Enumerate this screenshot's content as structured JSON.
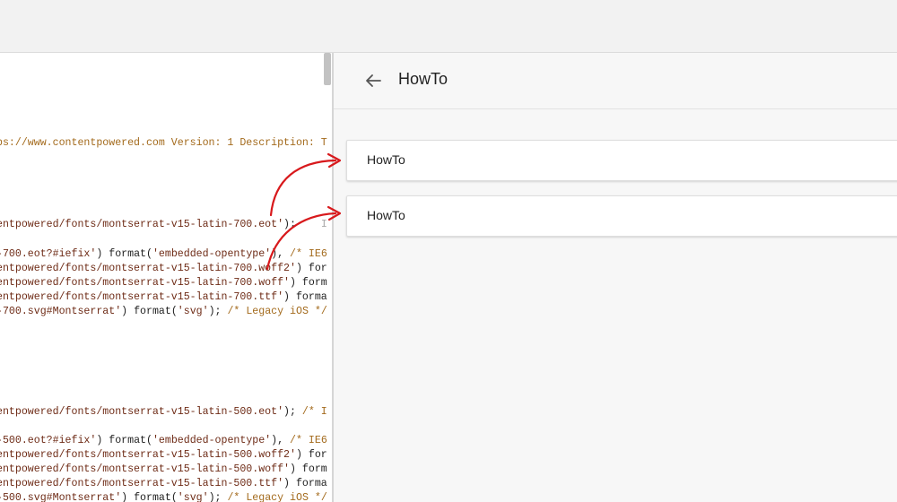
{
  "editor": {
    "lines": [
      {
        "parts": [
          {
            "t": "ps://www.contentpowered.com Version: 1 Description: T",
            "c": "cm"
          }
        ]
      },
      {
        "parts": [
          {
            "t": "entpowered/fonts/montserrat-v15-latin-700.eot'",
            "c": "str"
          },
          {
            "t": ");",
            "c": ""
          },
          {
            "t": "    ",
            "c": ""
          },
          {
            "t": "I",
            "c": "gry"
          }
        ]
      },
      {
        "parts": [
          {
            "t": "-700.eot?#iefix'",
            "c": "str"
          },
          {
            "t": ") format(",
            "c": ""
          },
          {
            "t": "'embedded-opentype'",
            "c": "str"
          },
          {
            "t": "), ",
            "c": ""
          },
          {
            "t": "/* IE6",
            "c": "cm"
          }
        ]
      },
      {
        "parts": [
          {
            "t": "entpowered/fonts/montserrat-v15-latin-700.woff2'",
            "c": "str"
          },
          {
            "t": ") for",
            "c": ""
          }
        ]
      },
      {
        "parts": [
          {
            "t": "entpowered/fonts/montserrat-v15-latin-700.woff'",
            "c": "str"
          },
          {
            "t": ") form",
            "c": ""
          }
        ]
      },
      {
        "parts": [
          {
            "t": "entpowered/fonts/montserrat-v15-latin-700.ttf'",
            "c": "str"
          },
          {
            "t": ") forma",
            "c": ""
          }
        ]
      },
      {
        "parts": [
          {
            "t": "-700.svg#Montserrat'",
            "c": "str"
          },
          {
            "t": ") format(",
            "c": ""
          },
          {
            "t": "'svg'",
            "c": "str"
          },
          {
            "t": "); ",
            "c": ""
          },
          {
            "t": "/* Legacy iOS */",
            "c": "cm"
          }
        ]
      },
      {
        "parts": [
          {
            "t": "entpowered/fonts/montserrat-v15-latin-500.eot'",
            "c": "str"
          },
          {
            "t": "); ",
            "c": ""
          },
          {
            "t": "/* I",
            "c": "cm"
          }
        ]
      },
      {
        "parts": [
          {
            "t": "-500.eot?#iefix'",
            "c": "str"
          },
          {
            "t": ") format(",
            "c": ""
          },
          {
            "t": "'embedded-opentype'",
            "c": "str"
          },
          {
            "t": "), ",
            "c": ""
          },
          {
            "t": "/* IE6",
            "c": "cm"
          }
        ]
      },
      {
        "parts": [
          {
            "t": "entpowered/fonts/montserrat-v15-latin-500.woff2'",
            "c": "str"
          },
          {
            "t": ") for",
            "c": ""
          }
        ]
      },
      {
        "parts": [
          {
            "t": "entpowered/fonts/montserrat-v15-latin-500.woff'",
            "c": "str"
          },
          {
            "t": ") form",
            "c": ""
          }
        ]
      },
      {
        "parts": [
          {
            "t": "entpowered/fonts/montserrat-v15-latin-500.ttf'",
            "c": "str"
          },
          {
            "t": ") forma",
            "c": ""
          }
        ]
      },
      {
        "parts": [
          {
            "t": "-500.svg#Montserrat'",
            "c": "str"
          },
          {
            "t": ") format(",
            "c": ""
          },
          {
            "t": "'svg'",
            "c": "str"
          },
          {
            "t": "); ",
            "c": ""
          },
          {
            "t": "/* Legacy iOS */",
            "c": "cm"
          }
        ]
      }
    ]
  },
  "panel": {
    "title": "HowTo",
    "back_icon": "arrow-left-icon",
    "items": [
      {
        "label": "HowTo"
      },
      {
        "label": "HowTo"
      }
    ]
  },
  "colors": {
    "annotation_arrow": "#d8191c",
    "code_comment": "#a36a1c",
    "code_string": "#6e2b16"
  }
}
